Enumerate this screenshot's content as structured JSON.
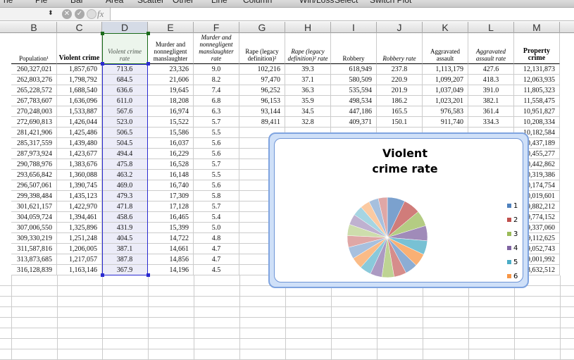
{
  "ribbon": {
    "items": [
      "ne",
      "Pie",
      "Bar",
      "Area",
      "Scatter",
      "Other",
      "Line",
      "Column",
      "Win/Loss",
      "Select",
      "Switch Plot"
    ]
  },
  "formula_bar": {
    "fx": "fx",
    "value": ""
  },
  "columns": [
    "B",
    "C",
    "D",
    "E",
    "F",
    "G",
    "H",
    "I",
    "J",
    "K",
    "L",
    "M"
  ],
  "headers": [
    "Population¹",
    "Violent crime",
    "Violent crime rate",
    "Murder and nonnegligent manslaughter",
    "Murder and nonnegligent manslaughter rate",
    "Rape (legacy definition)²",
    "Rape (legacy definition)² rate",
    "Robbery",
    "Robbery rate",
    "Aggravated assault",
    "Aggravated assault rate",
    "Property crime"
  ],
  "rows": [
    [
      "260,327,021",
      "1,857,670",
      "713.6",
      "23,326",
      "9.0",
      "102,216",
      "39.3",
      "618,949",
      "237.8",
      "1,113,179",
      "427.6",
      "12,131,873"
    ],
    [
      "262,803,276",
      "1,798,792",
      "684.5",
      "21,606",
      "8.2",
      "97,470",
      "37.1",
      "580,509",
      "220.9",
      "1,099,207",
      "418.3",
      "12,063,935"
    ],
    [
      "265,228,572",
      "1,688,540",
      "636.6",
      "19,645",
      "7.4",
      "96,252",
      "36.3",
      "535,594",
      "201.9",
      "1,037,049",
      "391.0",
      "11,805,323"
    ],
    [
      "267,783,607",
      "1,636,096",
      "611.0",
      "18,208",
      "6.8",
      "96,153",
      "35.9",
      "498,534",
      "186.2",
      "1,023,201",
      "382.1",
      "11,558,475"
    ],
    [
      "270,248,003",
      "1,533,887",
      "567.6",
      "16,974",
      "6.3",
      "93,144",
      "34.5",
      "447,186",
      "165.5",
      "976,583",
      "361.4",
      "10,951,827"
    ],
    [
      "272,690,813",
      "1,426,044",
      "523.0",
      "15,522",
      "5.7",
      "89,411",
      "32.8",
      "409,371",
      "150.1",
      "911,740",
      "334.3",
      "10,208,334"
    ],
    [
      "281,421,906",
      "1,425,486",
      "506.5",
      "15,586",
      "5.5",
      "",
      "",
      "",
      "",
      "",
      "",
      "10,182,584"
    ],
    [
      "285,317,559",
      "1,439,480",
      "504.5",
      "16,037",
      "5.6",
      "",
      "",
      "",
      "",
      "",
      "",
      "10,437,189"
    ],
    [
      "287,973,924",
      "1,423,677",
      "494.4",
      "16,229",
      "5.6",
      "",
      "",
      "",
      "",
      "",
      "",
      "10,455,277"
    ],
    [
      "290,788,976",
      "1,383,676",
      "475.8",
      "16,528",
      "5.7",
      "",
      "",
      "",
      "",
      "",
      "",
      "10,442,862"
    ],
    [
      "293,656,842",
      "1,360,088",
      "463.2",
      "16,148",
      "5.5",
      "",
      "",
      "",
      "",
      "",
      "",
      "10,319,386"
    ],
    [
      "296,507,061",
      "1,390,745",
      "469.0",
      "16,740",
      "5.6",
      "",
      "",
      "",
      "",
      "",
      "",
      "10,174,754"
    ],
    [
      "299,398,484",
      "1,435,123",
      "479.3",
      "17,309",
      "5.8",
      "",
      "",
      "",
      "",
      "",
      "",
      "10,019,601"
    ],
    [
      "301,621,157",
      "1,422,970",
      "471.8",
      "17,128",
      "5.7",
      "",
      "",
      "",
      "",
      "",
      "",
      "9,882,212"
    ],
    [
      "304,059,724",
      "1,394,461",
      "458.6",
      "16,465",
      "5.4",
      "",
      "",
      "",
      "",
      "",
      "",
      "9,774,152"
    ],
    [
      "307,006,550",
      "1,325,896",
      "431.9",
      "15,399",
      "5.0",
      "",
      "",
      "",
      "",
      "",
      "",
      "9,337,060"
    ],
    [
      "309,330,219",
      "1,251,248",
      "404.5",
      "14,722",
      "4.8",
      "",
      "",
      "",
      "",
      "",
      "",
      "9,112,625"
    ],
    [
      "311,587,816",
      "1,206,005",
      "387.1",
      "14,661",
      "4.7",
      "",
      "",
      "",
      "",
      "",
      "",
      "9,052,743"
    ],
    [
      "313,873,685",
      "1,217,057",
      "387.8",
      "14,856",
      "4.7",
      "",
      "",
      "",
      "",
      "",
      "",
      "9,001,992"
    ],
    [
      "316,128,839",
      "1,163,146",
      "367.9",
      "14,196",
      "4.5",
      "",
      "",
      "",
      "",
      "",
      "",
      "8,632,512"
    ]
  ],
  "chart": {
    "title": "Violent crime rate",
    "type": "pie",
    "values": [
      713.6,
      684.5,
      636.6,
      611.0,
      567.6,
      523.0,
      506.5,
      504.5,
      494.4,
      475.8,
      463.2,
      469.0,
      479.3,
      471.8,
      458.6,
      431.9,
      404.5,
      387.1,
      387.8,
      367.9
    ],
    "legend": [
      "1",
      "2",
      "3",
      "4",
      "5",
      "6"
    ],
    "colors": [
      "#4f81bd",
      "#c0504d",
      "#9bbb59",
      "#8064a2",
      "#4bacc6",
      "#f79646"
    ]
  }
}
